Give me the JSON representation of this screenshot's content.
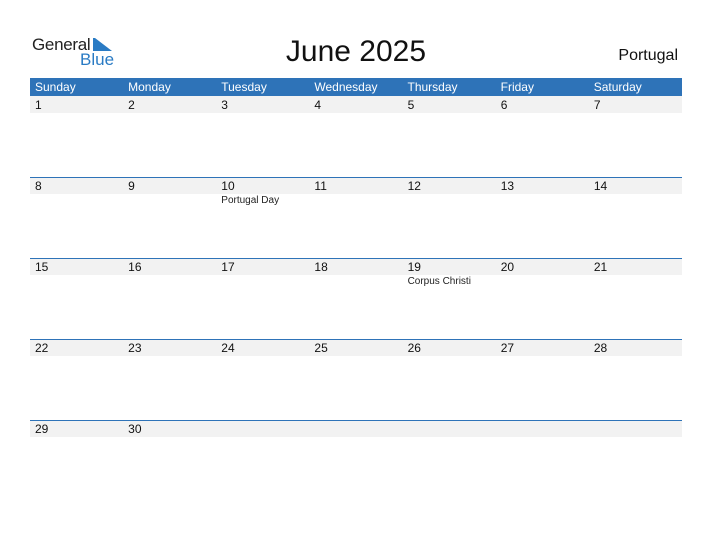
{
  "logo": {
    "part1": "General",
    "part2": "Blue"
  },
  "title": "June 2025",
  "country": "Portugal",
  "colors": {
    "accent": "#2e73b8",
    "strip": "#f2f2f2",
    "logo_blue": "#2a7bc4"
  },
  "day_names": [
    "Sunday",
    "Monday",
    "Tuesday",
    "Wednesday",
    "Thursday",
    "Friday",
    "Saturday"
  ],
  "weeks": [
    [
      {
        "day": "1"
      },
      {
        "day": "2"
      },
      {
        "day": "3"
      },
      {
        "day": "4"
      },
      {
        "day": "5"
      },
      {
        "day": "6"
      },
      {
        "day": "7"
      }
    ],
    [
      {
        "day": "8"
      },
      {
        "day": "9"
      },
      {
        "day": "10",
        "holiday": "Portugal Day"
      },
      {
        "day": "11"
      },
      {
        "day": "12"
      },
      {
        "day": "13"
      },
      {
        "day": "14"
      }
    ],
    [
      {
        "day": "15"
      },
      {
        "day": "16"
      },
      {
        "day": "17"
      },
      {
        "day": "18"
      },
      {
        "day": "19",
        "holiday": "Corpus Christi"
      },
      {
        "day": "20"
      },
      {
        "day": "21"
      }
    ],
    [
      {
        "day": "22"
      },
      {
        "day": "23"
      },
      {
        "day": "24"
      },
      {
        "day": "25"
      },
      {
        "day": "26"
      },
      {
        "day": "27"
      },
      {
        "day": "28"
      }
    ],
    [
      {
        "day": "29"
      },
      {
        "day": "30"
      },
      {
        "day": ""
      },
      {
        "day": ""
      },
      {
        "day": ""
      },
      {
        "day": ""
      },
      {
        "day": ""
      }
    ]
  ]
}
